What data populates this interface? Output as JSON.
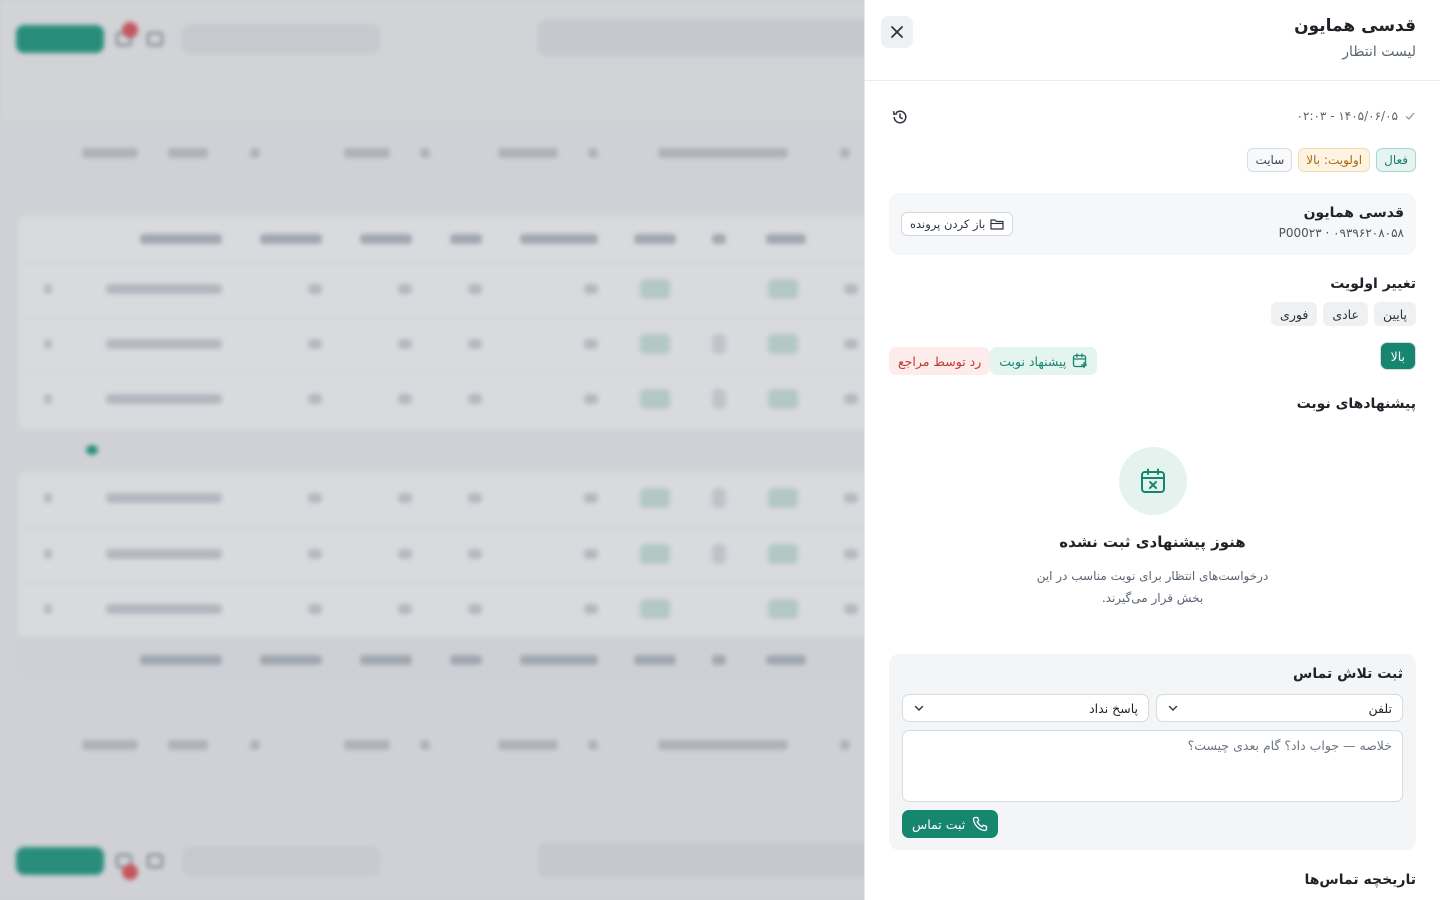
{
  "panel": {
    "title": "قدسی همایون",
    "subtitle": "لیست انتظار",
    "timestamp": "۱۴۰۵/۰۶/۰۵ - ۰۲:۰۳",
    "badges": {
      "status": "فعال",
      "priority": "اولویت: بالا",
      "source": "سایت"
    },
    "patient_card": {
      "name": "قدسی همایون",
      "info": "P000۲۳ · ۰۹۳۹۶۲۰۸۰۵۸",
      "open_file_label": "باز کردن پرونده"
    },
    "change_priority": {
      "title": "تغییر اولویت",
      "options": [
        "پایین",
        "عادی",
        "بالا",
        "فوری"
      ],
      "selected": "بالا"
    },
    "actions": {
      "suggest_label": "پیشنهاد نوبت",
      "reject_label": "رد توسط مراجع"
    },
    "suggestions": {
      "title": "پیشنهادهای نوبت",
      "empty_title": "هنوز پیشنهادی ثبت نشده",
      "empty_desc": "درخواست‌های انتظار برای نوبت مناسب در این بخش قرار می‌گیرند."
    },
    "call_log": {
      "title": "ثبت تلاش تماس",
      "channel_value": "تلفن",
      "result_value": "پاسخ نداد",
      "notes_placeholder": "خلاصه — جواب داد؟ گام بعدی چیست؟",
      "submit_label": "ثبت تماس"
    },
    "call_history_title": "تاریخچه تماس‌ها"
  },
  "colors": {
    "accent": "#17866f",
    "accent_light": "#e4f4ef",
    "danger": "#c0392b",
    "warning": "#a86b12"
  }
}
